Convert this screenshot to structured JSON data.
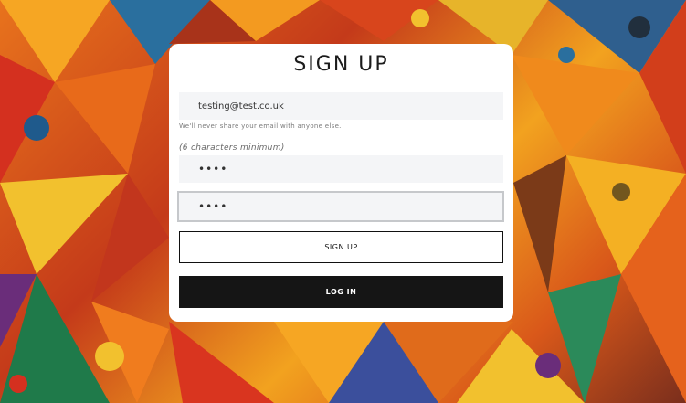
{
  "form": {
    "title": "SIGN UP",
    "email_value": "testing@test.co.uk",
    "email_help": "We'll never share your email with anyone else.",
    "password_hint": "(6 characters minimum)",
    "password_value": "••••",
    "confirm_value": "••••",
    "signup_label": "SIGN UP",
    "login_label": "LOG IN"
  },
  "colors": {
    "card": "#ffffff",
    "field_bg": "#f4f5f7",
    "dark_button": "#151515",
    "outline": "#111111"
  }
}
